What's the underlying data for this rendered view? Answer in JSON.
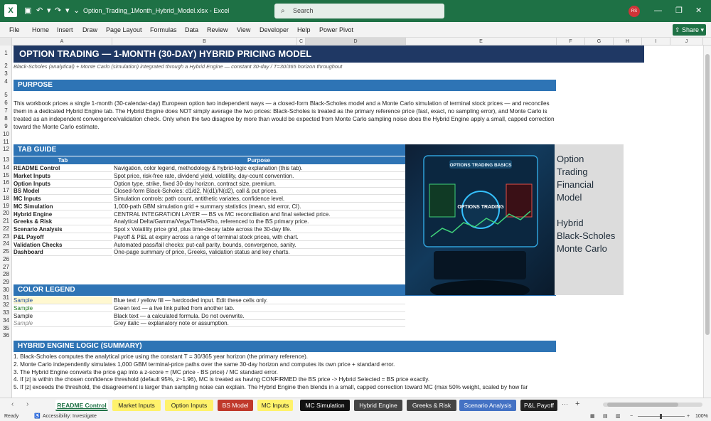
{
  "titlebar": {
    "filename": "Option_Trading_1Month_Hybrid_Model.xlsx",
    "app": "Excel",
    "search_placeholder": "Search",
    "avatar": "RS"
  },
  "menu": [
    "File",
    "Home",
    "Insert",
    "Draw",
    "Page Layout",
    "Formulas",
    "Data",
    "Review",
    "View",
    "Developer",
    "Help",
    "Power Pivot"
  ],
  "share_label": "Share",
  "columns": [
    "A",
    "B",
    "C",
    "D",
    "E",
    "F",
    "G",
    "H",
    "I",
    "J"
  ],
  "rows": [
    "1",
    "2",
    "3",
    "4",
    "5",
    "6",
    "7",
    "8",
    "9",
    "10",
    "11",
    "12",
    "13",
    "14",
    "15",
    "16",
    "17",
    "18",
    "19",
    "20",
    "21",
    "22",
    "23",
    "24",
    "25",
    "26",
    "27",
    "28",
    "29",
    "30",
    "31",
    "32",
    "33",
    "34",
    "35",
    "36"
  ],
  "sheet": {
    "title": "OPTION TRADING — 1-MONTH (30-DAY) HYBRID PRICING MODEL",
    "subtitle": "Black-Scholes (analytical) + Monte Carlo (simulation) integrated through a Hybrid Engine — constant 30-day / T=30/365 horizon throughout",
    "purpose_header": "PURPOSE",
    "purpose_text": "This workbook prices a single 1-month (30-calendar-day) European option two independent ways — a closed-form Black-Scholes model and a Monte Carlo simulation of terminal stock prices — and reconciles them in a dedicated Hybrid Engine tab. The Hybrid Engine does NOT simply average the two prices: Black-Scholes is treated as the primary reference price (fast, exact, no sampling error), and Monte Carlo is treated as an independent convergence/validation check. Only when the two disagree by more than would be expected from Monte Carlo sampling noise does the Hybrid Engine apply a small, capped correction toward the Monte Carlo estimate.",
    "tab_guide_header": "TAB GUIDE",
    "tab_col": "Tab",
    "purpose_col": "Purpose",
    "tabs": [
      {
        "name": "README Control",
        "purpose": "Navigation, color legend, methodology & hybrid-logic explanation (this tab)."
      },
      {
        "name": "Market Inputs",
        "purpose": "Spot price, risk-free rate, dividend yield, volatility, day-count convention."
      },
      {
        "name": "Option Inputs",
        "purpose": "Option type, strike, fixed 30-day horizon, contract size, premium."
      },
      {
        "name": "BS Model",
        "purpose": "Closed-form Black-Scholes: d1/d2, N(d1)/N(d2), call & put prices."
      },
      {
        "name": "MC Inputs",
        "purpose": "Simulation controls: path count, antithetic variates, confidence level."
      },
      {
        "name": "MC Simulation",
        "purpose": "1,000-path GBM simulation grid + summary statistics (mean, std error, CI)."
      },
      {
        "name": "Hybrid Engine",
        "purpose": "CENTRAL INTEGRATION LAYER — BS vs MC reconciliation and final selected price."
      },
      {
        "name": "Greeks & Risk",
        "purpose": "Analytical Delta/Gamma/Vega/Theta/Rho, referenced to the BS primary price."
      },
      {
        "name": "Scenario Analysis",
        "purpose": "Spot x Volatility price grid, plus time-decay table across the 30-day life."
      },
      {
        "name": "P&L Payoff",
        "purpose": "Payoff & P&L at expiry across a range of terminal stock prices, with chart."
      },
      {
        "name": "Validation Checks",
        "purpose": "Automated pass/fail checks: put-call parity, bounds, convergence, sanity."
      },
      {
        "name": "Dashboard",
        "purpose": "One-page summary of price, Greeks, validation status and key charts."
      }
    ],
    "color_legend_header": "COLOR LEGEND",
    "legend": [
      {
        "sample": "Sample",
        "desc": "Blue text / yellow fill — hardcoded input. Edit these cells only.",
        "color": "#1f4e9c",
        "fill": "#fff8d0"
      },
      {
        "sample": "Sample",
        "desc": "Green text — a live link pulled from another tab.",
        "color": "#1f7a1f",
        "fill": "#ffffff"
      },
      {
        "sample": "Sample",
        "desc": "Black text — a calculated formula. Do not overwrite.",
        "color": "#222222",
        "fill": "#ffffff"
      },
      {
        "sample": "Sample",
        "desc": "Grey italic — explanatory note or assumption.",
        "color": "#888888",
        "fill": "#ffffff"
      }
    ],
    "logic_header": "HYBRID ENGINE LOGIC (SUMMARY)",
    "logic": [
      "1. Black-Scholes computes the analytical price using the constant T = 30/365 year horizon (the primary reference).",
      "2. Monte Carlo independently simulates 1,000 GBM terminal-price paths over the same 30-day horizon and computes its own price + standard error.",
      "3. The Hybrid Engine converts the price gap into a z-score = (MC price - BS price) / MC standard error.",
      "4. If |z| is within the chosen confidence threshold (default 95%, z~1.96), MC is treated as having CONFIRMED the BS price -> Hybrid Selected = BS price exactly.",
      "5. If |z| exceeds the threshold, the disagreement is larger than sampling noise can explain. The Hybrid Engine then blends in a small, capped correction toward MC (max 50% weight, scaled by how far"
    ]
  },
  "promo": {
    "lines": [
      "Option",
      "Trading",
      "Financial",
      "Model",
      "",
      "Hybrid",
      "Black-Scholes",
      "Monte Carlo"
    ],
    "screen_title": "OPTIONS TRADING BASICS",
    "center": "OPTIONS TRADING"
  },
  "sheet_tabs": [
    {
      "label": "README Control",
      "bg": "#ffffff",
      "fg": "#1e7145"
    },
    {
      "label": "Market Inputs",
      "bg": "#fff26b",
      "fg": "#222222"
    },
    {
      "label": "Option Inputs",
      "bg": "#fff26b",
      "fg": "#222222"
    },
    {
      "label": "BS Model",
      "bg": "#c0392b",
      "fg": "#ffffff"
    },
    {
      "label": "MC Inputs",
      "bg": "#fff26b",
      "fg": "#222222"
    },
    {
      "label": "MC Simulation",
      "bg": "#111111",
      "fg": "#ffffff"
    },
    {
      "label": "Hybrid Engine",
      "bg": "#444444",
      "fg": "#ffffff"
    },
    {
      "label": "Greeks & Risk",
      "bg": "#444444",
      "fg": "#ffffff"
    },
    {
      "label": "Scenario Analysis",
      "bg": "#4472c4",
      "fg": "#ffffff"
    },
    {
      "label": "P&L Payoff",
      "bg": "#222222",
      "fg": "#ffffff"
    }
  ],
  "status": {
    "ready": "Ready",
    "accessibility": "Accessibility: Investigate",
    "zoom": "100%"
  }
}
